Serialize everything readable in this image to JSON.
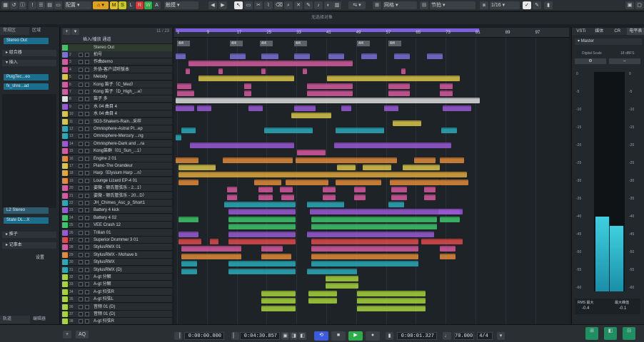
{
  "toolbar": {
    "mode_label": "配置",
    "buttons": [
      "M",
      "S",
      "L",
      "R",
      "W",
      "A"
    ],
    "auto_label": "触摸",
    "grid_label": "网格",
    "snap_label": "节拍",
    "quant_label": "1/16"
  },
  "status_text": "无选择对象",
  "left_zone": {
    "tabs": [
      "常规区",
      "区域"
    ],
    "stereo_out": "Stereo Out",
    "section_insert": "组合器",
    "section_plugin": "插入",
    "plugins": [
      "PuigTec...eo",
      "fx_shre...ad"
    ],
    "l2_stereo": "L2 Stereo",
    "state_label": "State DL...X",
    "section_sends": "推子",
    "section_notes": "记事本",
    "settings_label": "设置",
    "bottom_tabs": [
      "轨道",
      "编辑器"
    ]
  },
  "track_header": {
    "count": "11 / 23",
    "first_row": "插入/播放 通道",
    "stereo_out_row": "Stereo Out"
  },
  "tracks": [
    {
      "name": "拍号",
      "color": "#7c6fd6"
    },
    {
      "name": "作曲demo",
      "color": "#d65a9f"
    },
    {
      "name": "外协-客户试听版本",
      "color": "#d65a9f"
    },
    {
      "name": "Melody",
      "color": "#d9c44a"
    },
    {
      "name": "Kong 笛子（C_Med）",
      "color": "#d65a9f"
    },
    {
      "name": "Kong 笛子（D_High_...e）",
      "color": "#d65a9f"
    },
    {
      "name": "笛子 多",
      "color": "#e0e0e0"
    },
    {
      "name": "水 04 曲目 4",
      "color": "#9a5ad6"
    },
    {
      "name": "水 04 曲目 4",
      "color": "#d9c44a"
    },
    {
      "name": "SD3-Shakers-Rain...采样",
      "color": "#d9c44a"
    },
    {
      "name": "Omnisphere-Astral Pl...ep",
      "color": "#2aa9b8"
    },
    {
      "name": "Omnisphere-Mercury ...ng",
      "color": "#2aa9b8"
    },
    {
      "name": "Omnisphere-Dark and ...ra",
      "color": "#9a5ad6"
    },
    {
      "name": "Kong笛群（01_Sun_...1）",
      "color": "#d65a9f"
    },
    {
      "name": "Engine 2 01",
      "color": "#e08a3a"
    },
    {
      "name": "Piano-The Grandeur",
      "color": "#d9c44a"
    },
    {
      "name": "Harp（Elysium Harp ...n）",
      "color": "#e0a83a"
    },
    {
      "name": "Lounge Lizard EP-4 01",
      "color": "#e08a3a"
    },
    {
      "name": "姿微 - 顿氏管弦乐 - 2...1）",
      "color": "#d65a9f"
    },
    {
      "name": "姿微 - 顿氏管弦乐 - 20...D）",
      "color": "#d65a9f"
    },
    {
      "name": "JH_Chimes_Asc_p_Short1",
      "color": "#2aa9b8"
    },
    {
      "name": "Battery 4 kick",
      "color": "#9a5ad6"
    },
    {
      "name": "Battery 4 02",
      "color": "#3fc46a"
    },
    {
      "name": "VEE Crash 12",
      "color": "#3fc46a"
    },
    {
      "name": "Trilian 01",
      "color": "#9a5ad6"
    },
    {
      "name": "Superior Drummer 3 01",
      "color": "#e04a4a"
    },
    {
      "name": "StylusRMX 01",
      "color": "#d65a9f"
    },
    {
      "name": "StylusRMX - Mohave b",
      "color": "#e08a3a"
    },
    {
      "name": "StylusRMX",
      "color": "#2aa9b8"
    },
    {
      "name": "StylusRMX (D)",
      "color": "#2aa9b8"
    },
    {
      "name": "A-gt 分解",
      "color": "#a6d43a"
    },
    {
      "name": "A-gt 分解",
      "color": "#a6d43a"
    },
    {
      "name": "A-gt 扫弦R",
      "color": "#a6d43a"
    },
    {
      "name": "A-gt 扫弦L",
      "color": "#a6d43a"
    },
    {
      "name": "音频 01 (D)",
      "color": "#a6d43a"
    },
    {
      "name": "音频 01 (D)",
      "color": "#a6d43a"
    },
    {
      "name": "A-gt 扫弦R",
      "color": "#a6d43a"
    }
  ],
  "ruler": {
    "bars": [
      "1",
      "9",
      "17",
      "25",
      "33",
      "41",
      "49",
      "57",
      "65",
      "73",
      "81",
      "89",
      "97"
    ]
  },
  "right_zone": {
    "tabs": [
      "VSTi",
      "媒体",
      "CR",
      "电平表"
    ],
    "master_label": "Master",
    "digital_scale": "Digital Scale",
    "scale_value": "18 dBFS",
    "db_marks": [
      "0",
      "-5",
      "-10",
      "-15",
      "-20",
      "-25",
      "-30",
      "-35",
      "-40",
      "-45",
      "-50",
      "-55",
      "-60"
    ],
    "rms_label": "RMS 最大",
    "peak_label": "最大峰值",
    "rms_value": "-0.4",
    "peak_value": "-0.1",
    "meter_left_level": 0.34,
    "meter_right_level": 0.3
  },
  "transport": {
    "start_time": "0:00:00.000",
    "end_time": "0:04:30.857",
    "position": "0:00:01.327",
    "tempo": "70.000",
    "signature": "4/4"
  }
}
